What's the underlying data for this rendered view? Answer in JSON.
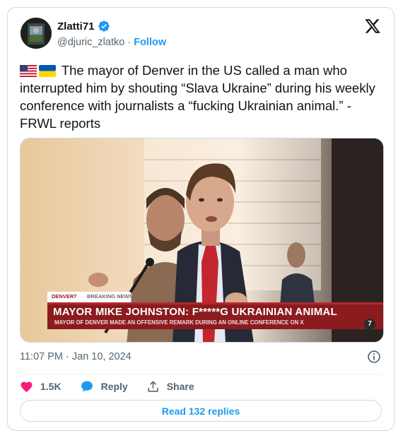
{
  "author": {
    "display_name": "Zlatti71",
    "handle": "@djuric_zlatko",
    "separator": "·",
    "follow_label": "Follow"
  },
  "tweet": {
    "flags": [
      "us-flag-icon",
      "ukraine-flag-icon"
    ],
    "text": "The mayor of Denver in the US called a man who interrupted him by shouting “Slava Ukraine” during his weekly conference with journalists a “fucking Ukrainian animal.” - FRWL reports"
  },
  "media": {
    "station": "DENVER7",
    "tag": "BREAKING NEWS",
    "headline": "MAYOR MIKE JOHNSTON: F*****G UKRAINIAN ANIMAL",
    "subheadline": "MAYOR OF DENVER MADE AN OFFENSIVE REMARK DURING AN ONLINE CONFERENCE ON X",
    "corner_logo": "7"
  },
  "meta": {
    "timestamp": "11:07 PM · Jan 10, 2024"
  },
  "actions": {
    "likes": "1.5K",
    "reply_label": "Reply",
    "share_label": "Share"
  },
  "read_replies_label": "Read 132 replies",
  "colors": {
    "accent": "#1d9bf0",
    "like": "#f91880",
    "banner_red": "#8b1b1f",
    "muted": "#536471"
  }
}
